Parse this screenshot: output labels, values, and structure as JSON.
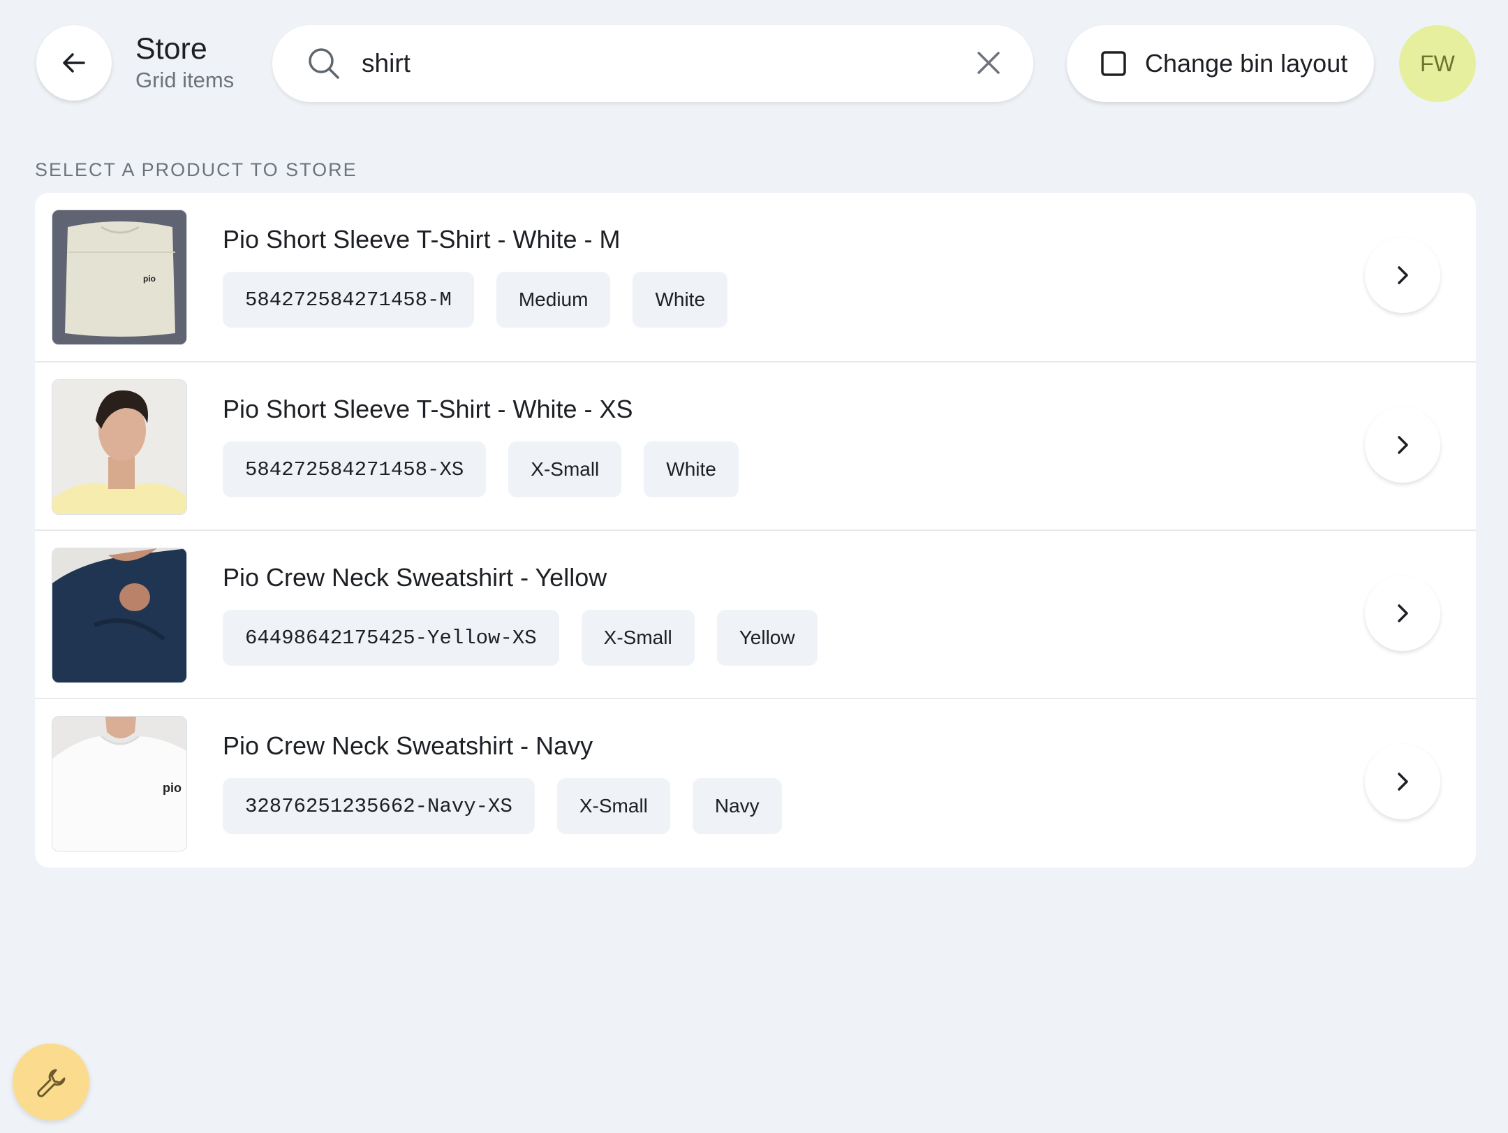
{
  "header": {
    "title": "Store",
    "subtitle": "Grid items",
    "back_icon": "arrow-left-icon"
  },
  "search": {
    "value": "shirt",
    "icon": "search-icon",
    "clear_icon": "close-icon"
  },
  "layout_button": {
    "label": "Change bin layout",
    "icon": "square-icon"
  },
  "avatar": {
    "initials": "FW",
    "color": "#e5ef9d"
  },
  "section_label": "SELECT A PRODUCT TO STORE",
  "products": [
    {
      "title": "Pio Short Sleeve T-Shirt - White - M",
      "sku": "584272584271458-M",
      "size": "Medium",
      "color": "White",
      "thumb": "folded-cream-tshirt"
    },
    {
      "title": "Pio Short Sleeve T-Shirt - White - XS",
      "sku": "584272584271458-XS",
      "size": "X-Small",
      "color": "White",
      "thumb": "man-yellow-tshirt"
    },
    {
      "title": "Pio Crew Neck Sweatshirt - Yellow",
      "sku": "64498642175425-Yellow-XS",
      "size": "X-Small",
      "color": "Yellow",
      "thumb": "navy-sweatshirt-closeup"
    },
    {
      "title": "Pio Crew Neck Sweatshirt - Navy",
      "sku": "32876251235662-Navy-XS",
      "size": "X-Small",
      "color": "Navy",
      "thumb": "white-tshirt-logo"
    }
  ],
  "fab": {
    "icon": "wrench-icon",
    "color": "#fbdc8e"
  },
  "thumb_logo_text": "pio"
}
